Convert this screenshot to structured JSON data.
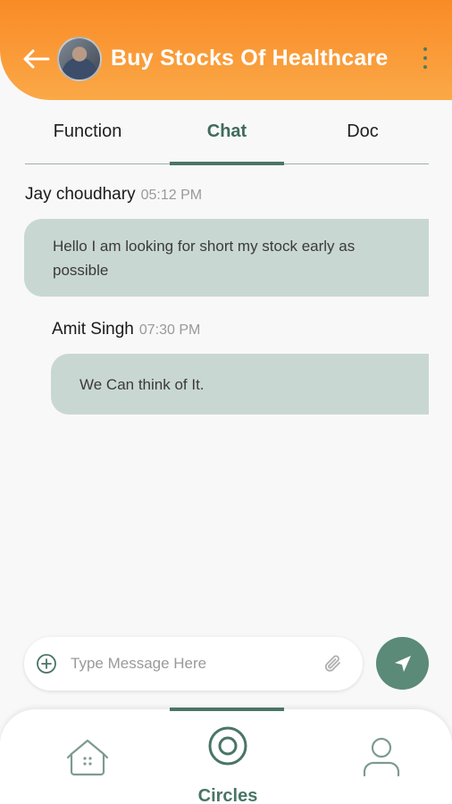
{
  "header": {
    "title": "Buy Stocks Of Healthcare",
    "back_icon": "arrow-left-icon",
    "menu_icon": "more-vertical-icon",
    "avatar": "user-avatar"
  },
  "tabs": [
    {
      "label": "Function",
      "active": false
    },
    {
      "label": "Chat",
      "active": true
    },
    {
      "label": "Doc",
      "active": false
    }
  ],
  "messages": [
    {
      "sender": "Jay choudhary",
      "time": "05:12 PM",
      "text": "Hello I am looking for short my stock early as possible"
    },
    {
      "sender": "Amit Singh",
      "time": "07:30 PM",
      "text": "We Can think of It."
    }
  ],
  "composer": {
    "placeholder": "Type Message Here",
    "value": "",
    "add_icon": "plus-circle-icon",
    "attach_icon": "paperclip-icon",
    "send_icon": "send-icon"
  },
  "bottom_nav": {
    "items": [
      {
        "icon": "home-icon",
        "label": ""
      },
      {
        "icon": "circles-icon",
        "label": "Circles",
        "active": true
      },
      {
        "icon": "profile-icon",
        "label": ""
      }
    ]
  },
  "colors": {
    "header_orange": "#f98b26",
    "accent_green": "#4a7566",
    "bubble_bg": "#c9d7d2",
    "send_button": "#5b8a78"
  }
}
